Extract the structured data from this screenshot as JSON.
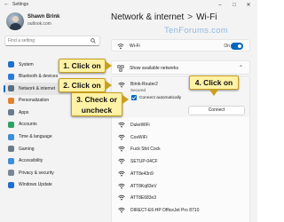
{
  "window": {
    "app_title": "Settings",
    "back_icon": "back-arrow-icon",
    "controls": [
      "minimize",
      "maximize",
      "close"
    ]
  },
  "profile": {
    "name": "Shawn Brink",
    "email": "outlook.com"
  },
  "search": {
    "placeholder": "Find a setting",
    "icon": "search-icon"
  },
  "sidebar": {
    "items": [
      {
        "label": "System",
        "icon": "system-icon",
        "color": "#1e6fd0",
        "selected": false
      },
      {
        "label": "Bluetooth & devices",
        "icon": "bluetooth-icon",
        "color": "#2a7ad8",
        "selected": false
      },
      {
        "label": "Network & internet",
        "icon": "network-icon",
        "color": "#5c6e82",
        "selected": true
      },
      {
        "label": "Personalization",
        "icon": "brush-icon",
        "color": "#e0832c",
        "selected": false
      },
      {
        "label": "Apps",
        "icon": "apps-icon",
        "color": "#6b7b8c",
        "selected": false
      },
      {
        "label": "Accounts",
        "icon": "accounts-icon",
        "color": "#2fa05f",
        "selected": false
      },
      {
        "label": "Time & language",
        "icon": "clock-icon",
        "color": "#3b8ed8",
        "selected": false
      },
      {
        "label": "Gaming",
        "icon": "gaming-icon",
        "color": "#6b7b8c",
        "selected": false
      },
      {
        "label": "Accessibility",
        "icon": "accessibility-icon",
        "color": "#3b8ed8",
        "selected": false
      },
      {
        "label": "Privacy & security",
        "icon": "shield-icon",
        "color": "#7b8794",
        "selected": false
      },
      {
        "label": "Windows Update",
        "icon": "update-icon",
        "color": "#1e6fd0",
        "selected": false
      }
    ]
  },
  "breadcrumb": {
    "parent": "Network & internet",
    "separator": ">",
    "current": "Wi-Fi"
  },
  "watermark": "TenForums.com",
  "wifi": {
    "label": "Wi-Fi",
    "state": "On",
    "toggle_on": true
  },
  "show_networks": {
    "label": "Show available networks",
    "expanded": true
  },
  "selected_network": {
    "name": "Brink-Router2",
    "status": "Secured",
    "auto_connect_label": "Connect automatically",
    "auto_connect_checked": true,
    "connect_label": "Connect"
  },
  "networks": [
    {
      "name": "DukeWiFi"
    },
    {
      "name": "CoxWiFi"
    },
    {
      "name": "Fuck Shit Cock"
    },
    {
      "name": "SETUP-04CF"
    },
    {
      "name": "ATT8e43n9"
    },
    {
      "name": "ATT8Kq83eV"
    },
    {
      "name": "ATT8E683n3"
    },
    {
      "name": "DIRECT-E6-HP OfficeJet Pro 8710"
    }
  ],
  "callouts": {
    "c1": {
      "text": "1. Click on",
      "color": "#fff2a5"
    },
    "c2": {
      "text": "2. Click on"
    },
    "c3_line1": "3. Check or",
    "c3_line2": "uncheck",
    "c4": {
      "text": "4. Click on"
    }
  }
}
